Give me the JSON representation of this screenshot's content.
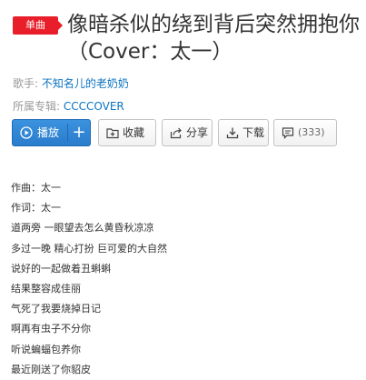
{
  "song": {
    "badge": "单曲",
    "title": "像暗杀似的绕到背后突然拥抱你",
    "subtitle": "（Cover：太一）"
  },
  "meta": {
    "artist_label": "歌手:",
    "artist": "不知名儿的老奶奶",
    "album_label": "所属专辑:",
    "album": "CCCCOVER"
  },
  "toolbar": {
    "play_label": "播放",
    "add_label": "+",
    "collect_label": "收藏",
    "share_label": "分享",
    "download_label": "下载",
    "comment_count": "(333)"
  },
  "lyrics": [
    "作曲：太一",
    "作词：太一",
    "道两旁 一眼望去怎么黄昏秋凉凉",
    "多过一晚 精心打扮 巨可爱的大自然",
    "说好的一起做着丑蝌蝌",
    "结果整容成佳丽",
    "气死了我要烧掉日记",
    "啊再有虫子不分你",
    "听说蝙蝠包养你",
    "最近刚送了你貂皮"
  ],
  "colors": {
    "badge_red": "#e81f2a",
    "link_blue": "#0c73c2",
    "play_blue": "#2a7ccc"
  },
  "icons": {
    "play": "play-circle-icon",
    "collect": "folder-plus-icon",
    "share": "share-arrow-icon",
    "download": "download-icon",
    "comment": "comment-bubble-icon"
  }
}
